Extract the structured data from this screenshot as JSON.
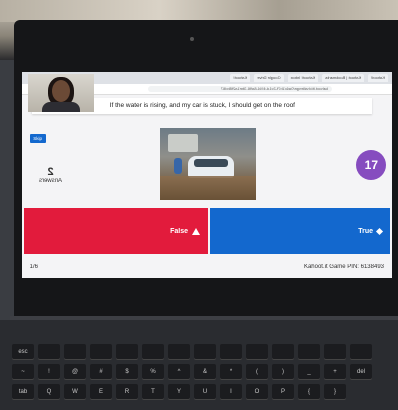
{
  "browser": {
    "tabs": [
      "Kahoot!",
      "Kahoot | Bookmarks",
      "Kahoot! Inbox",
      "Google Drive",
      "Kahoot!"
    ],
    "url": "kahoot.it/challenge/0a4c1b7f-2c1d-4f44-8a96-3be1a2f8bd67"
  },
  "question": {
    "text": "If the water is rising, and my car is stuck, I should get on the roof"
  },
  "timer": {
    "value": "17"
  },
  "skip": {
    "label": "Skip"
  },
  "answers_count": {
    "num": "2",
    "label": "Answers"
  },
  "answers": [
    {
      "label": "True",
      "color": "#1368ce",
      "shape": "diamond-icon"
    },
    {
      "label": "False",
      "color": "#e21b3c",
      "shape": "triangle-icon"
    }
  ],
  "footer": {
    "progress": "1/6",
    "game_info": "Kahoot.it  Game PIN: 6138493"
  },
  "keyboard": {
    "row1": [
      "esc",
      "",
      "",
      "",
      "",
      "",
      "",
      "",
      "",
      "",
      "",
      "",
      "",
      ""
    ],
    "row2": [
      "~",
      "!",
      "@",
      "#",
      "$",
      "%",
      "^",
      "&",
      "*",
      "(",
      ")",
      "_",
      "+",
      "del"
    ],
    "row3": [
      "tab",
      "Q",
      "W",
      "E",
      "R",
      "T",
      "Y",
      "U",
      "I",
      "O",
      "P",
      "{",
      "}"
    ]
  }
}
